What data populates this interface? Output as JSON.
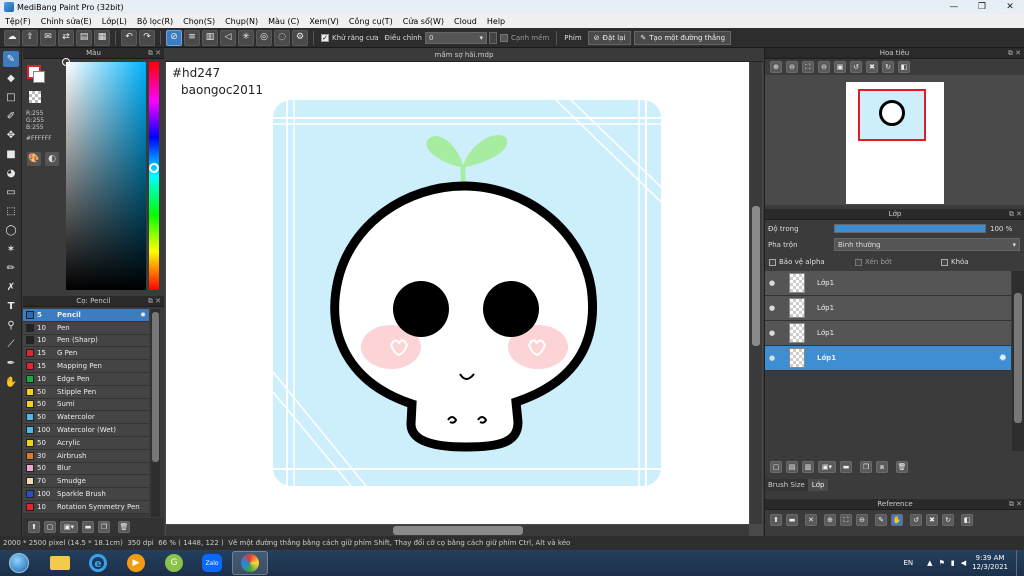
{
  "window": {
    "title": "MediBang Paint Pro (32bit)"
  },
  "menu": [
    "Tệp(F)",
    "Chỉnh sửa(E)",
    "Lớp(L)",
    "Bộ lọc(R)",
    "Chọn(S)",
    "Chụp(N)",
    "Màu (C)",
    "Xem(V)",
    "Công cụ(T)",
    "Cửa sổ(W)",
    "Cloud",
    "Help"
  ],
  "toolbar": {
    "antialias_label": "Khử răng cưa",
    "correction_label": "Điều chỉnh",
    "correction_value": "0",
    "sharp_label": "Cạnh mềm",
    "key_label": "Phím",
    "reset_label": "Đặt lại",
    "line_label": "Tạo một đường thẳng"
  },
  "color_panel": {
    "title": "Màu",
    "rgb_r": "R:255",
    "rgb_g": "G:255",
    "rgb_b": "B:255",
    "hex": "#FFFFFF",
    "primary_color": "#e31e24"
  },
  "brush_panel": {
    "title": "Cọ: Pencil",
    "items": [
      {
        "size": "5",
        "name": "Pencil",
        "color": "#2a6db5"
      },
      {
        "size": "10",
        "name": "Pen",
        "color": "#222222"
      },
      {
        "size": "10",
        "name": "Pen (Sharp)",
        "color": "#222222"
      },
      {
        "size": "15",
        "name": "G Pen",
        "color": "#e3232d"
      },
      {
        "size": "15",
        "name": "Mapping Pen",
        "color": "#e3232d"
      },
      {
        "size": "10",
        "name": "Edge Pen",
        "color": "#22a83a"
      },
      {
        "size": "50",
        "name": "Stipple Pen",
        "color": "#f0d21e"
      },
      {
        "size": "50",
        "name": "Sumi",
        "color": "#f0d21e"
      },
      {
        "size": "50",
        "name": "Watercolor",
        "color": "#55b7ea"
      },
      {
        "size": "100",
        "name": "Watercolor (Wet)",
        "color": "#55b7ea"
      },
      {
        "size": "50",
        "name": "Acrylic",
        "color": "#f0d21e"
      },
      {
        "size": "30",
        "name": "Airbrush",
        "color": "#e07a2a"
      },
      {
        "size": "50",
        "name": "Blur",
        "color": "#f3a6d4"
      },
      {
        "size": "70",
        "name": "Smudge",
        "color": "#f5d9b0"
      },
      {
        "size": "100",
        "name": "Sparkle Brush",
        "color": "#2a4fc0"
      },
      {
        "size": "10",
        "name": "Rotation Symmetry Pen",
        "color": "#e3232d"
      }
    ]
  },
  "canvas": {
    "tab_title": "mầm sợ hãi.mdp",
    "text_line1": "#hd247",
    "text_line2": "baongoc2011",
    "background_color": "#cdeffb"
  },
  "navigator": {
    "title": "Hoa tiêu"
  },
  "layer_panel": {
    "title": "Lớp",
    "opacity_label": "Độ trong",
    "opacity_value": "100 %",
    "opacity_fraction": 1.0,
    "blend_label": "Pha trộn",
    "blend_value": "Bình thường",
    "protect_alpha": "Bảo vệ alpha",
    "clipping": "Xén bớt",
    "lock": "Khóa",
    "layers": [
      {
        "name": "Lớp1",
        "active": false
      },
      {
        "name": "Lớp1",
        "active": false
      },
      {
        "name": "Lớp1",
        "active": false
      },
      {
        "name": "Lớp1",
        "active": true
      }
    ],
    "tab_brush_size": "Brush Size",
    "tab_layer": "Lớp"
  },
  "reference_panel": {
    "title": "Reference"
  },
  "status": {
    "size": "2000 * 2500 pixel",
    "physical": "(14.5 * 18.1cm)",
    "dpi": "350 dpi",
    "zoom": "66 %",
    "coords": "( 1448, 122 )",
    "hint": "Vẽ một đường thẳng bằng cách giữ phím Shift, Thay đổi cỡ cọ bằng cách giữ phím Ctrl, Alt và kéo"
  },
  "taskbar": {
    "lang": "EN",
    "time": "9:39 AM",
    "date": "12/3/2021"
  }
}
